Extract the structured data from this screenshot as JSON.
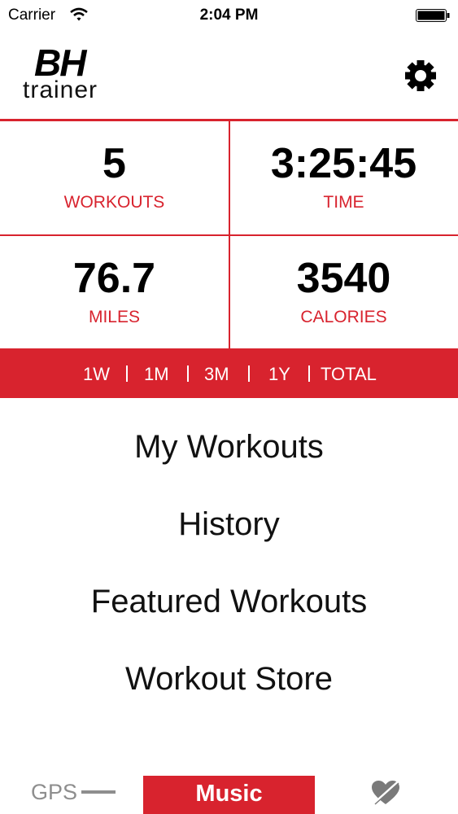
{
  "status_bar": {
    "carrier": "Carrier",
    "time": "2:04 PM",
    "wifi_icon": "wifi-icon",
    "battery_icon": "battery-icon"
  },
  "header": {
    "logo_primary": "BH",
    "logo_secondary": "trainer",
    "settings_icon": "gear-icon"
  },
  "stats": [
    {
      "value": "5",
      "label": "WORKOUTS"
    },
    {
      "value": "3:25:45",
      "label": "TIME"
    },
    {
      "value": "76.7",
      "label": "MILES"
    },
    {
      "value": "3540",
      "label": "CALORIES"
    }
  ],
  "periods": [
    "1W",
    "1M",
    "3M",
    "1Y",
    "TOTAL"
  ],
  "menu": [
    "My Workouts",
    "History",
    "Featured Workouts",
    "Workout Store"
  ],
  "bottom_bar": {
    "gps_label": "GPS",
    "music_label": "Music",
    "heart_icon": "heart-disabled-icon"
  },
  "colors": {
    "accent": "#d8232e",
    "muted": "#8e8e8e"
  }
}
